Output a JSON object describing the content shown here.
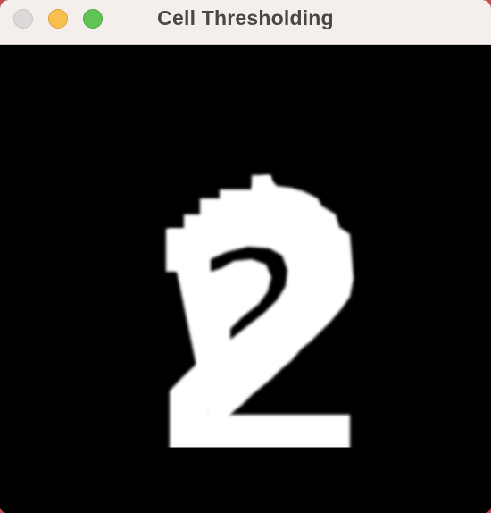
{
  "window": {
    "title": "Cell Thresholding",
    "colors": {
      "close": "#dcd9d8",
      "close_border": "#c8c4c3",
      "minimize": "#f7bf4f",
      "minimize_border": "#dda135",
      "zoom": "#61c554",
      "zoom_border": "#4ea840",
      "titlebar": "#f4efed",
      "canvas_background": "#000000",
      "foreground": "#ffffff"
    }
  },
  "image": {
    "description_icon": "thresholded-digit-image",
    "glyph": "2"
  }
}
